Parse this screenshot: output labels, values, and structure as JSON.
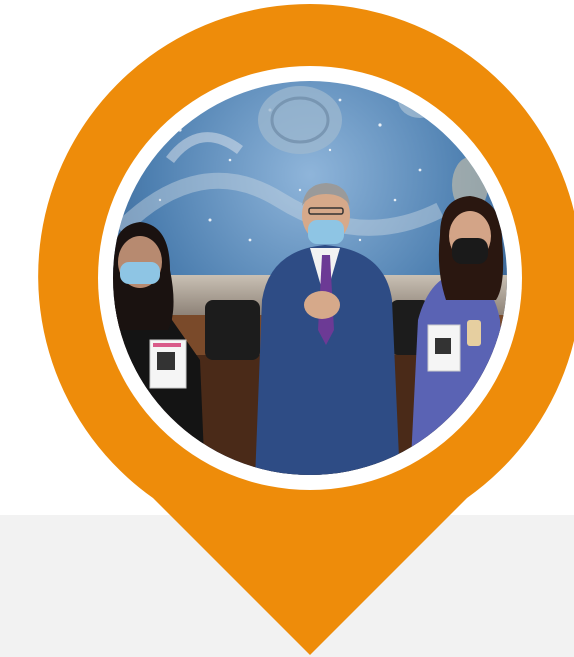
{
  "colors": {
    "pin": "#ee8c0a",
    "ring": "#ffffff",
    "panel": "#f2f2f2",
    "mural_sky": "#4d7fb0",
    "suit": "#2e4c85",
    "tie": "#6c3a95",
    "dress_right": "#5a63b4"
  },
  "pin": {
    "icon": "map-pin-icon",
    "photo_subject": "three-people-with-face-masks-holding-qr-code-cards"
  }
}
